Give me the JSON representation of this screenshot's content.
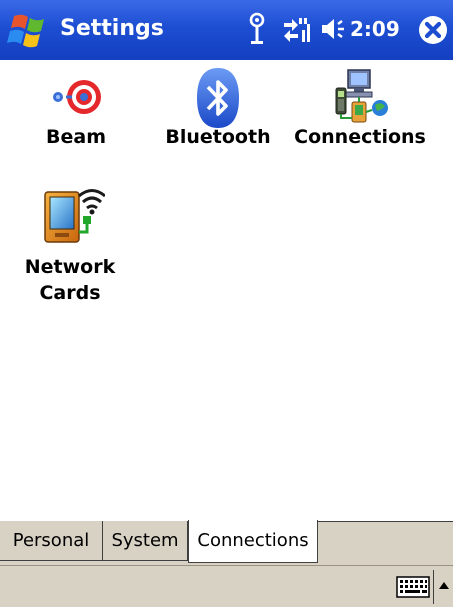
{
  "title_bar": {
    "app_title": "Settings",
    "clock": "2:09",
    "start_icon": "windows-flag-icon",
    "antenna_icon": "antenna-icon",
    "connectivity_icon": "connectivity-arrows-icon",
    "volume_icon": "speaker-icon",
    "close_icon": "close-circle-icon",
    "color": "#1d4ed2"
  },
  "items": [
    {
      "label": "Beam",
      "icon": "beam-icon"
    },
    {
      "label": "Bluetooth",
      "icon": "bluetooth-icon"
    },
    {
      "label": "Connections",
      "icon": "connections-icon"
    },
    {
      "label_line1": "Network",
      "label_line2": "Cards",
      "icon": "network-card-icon"
    }
  ],
  "tabs": [
    {
      "label": "Personal",
      "selected": false
    },
    {
      "label": "System",
      "selected": false
    },
    {
      "label": "Connections",
      "selected": true
    }
  ],
  "menu_bar": {
    "sip_icon": "keyboard-icon",
    "sip_arrow_icon": "up-arrow-icon",
    "background": "#d8d2c4"
  }
}
